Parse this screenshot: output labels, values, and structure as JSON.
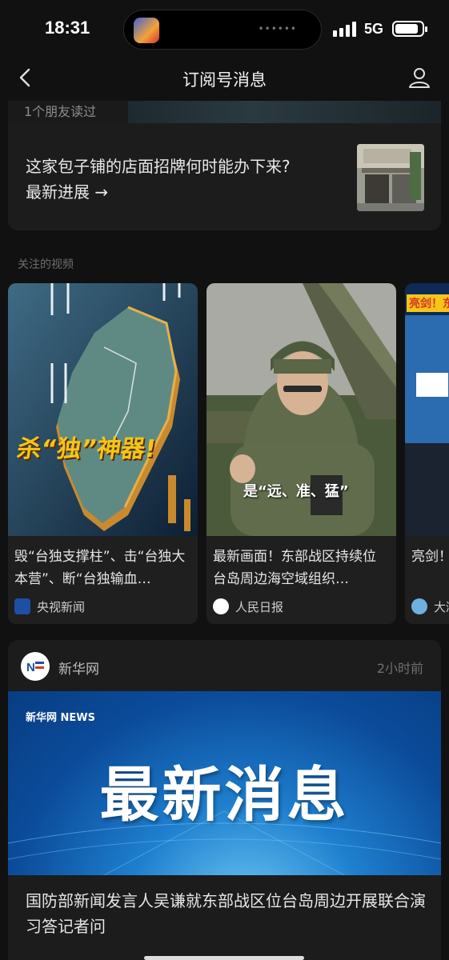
{
  "status": {
    "time": "18:31",
    "network": "5G"
  },
  "nav": {
    "title": "订阅号消息"
  },
  "card1": {
    "friends_read": "1个朋友读过",
    "title": "这家包子铺的店面招牌何时能办下来?",
    "link": "最新进展 →"
  },
  "section": {
    "label": "关注的视频"
  },
  "videos": [
    {
      "title": "毁“台独支撑柱”、击“台独大本营”、断“台独输血…",
      "source": "央视新闻",
      "overlay": "杀“独”神器!"
    },
    {
      "title": "最新画面！东部战区持续位台岛周边海空域组织…",
      "source": "人民日报",
      "overlay": "是“远、准、猛”"
    },
    {
      "title": "亮剑！东部战区发布海报 «",
      "source": "大湾区之声",
      "overlay": "亮剑！东部"
    }
  ],
  "xinhua": {
    "name": "新华网",
    "time": "2小时前",
    "banner_text": "最新消息",
    "banner_logo": "新华网 NEWS",
    "title": "国防部新闻发言人吴谦就东部战区位台岛周边开展联合演习答记者问"
  },
  "colors": {
    "background": "#111111",
    "card": "#1c1c1c",
    "banner_blue": "#1e7fce",
    "overlay_yellow": "#f5c518"
  }
}
